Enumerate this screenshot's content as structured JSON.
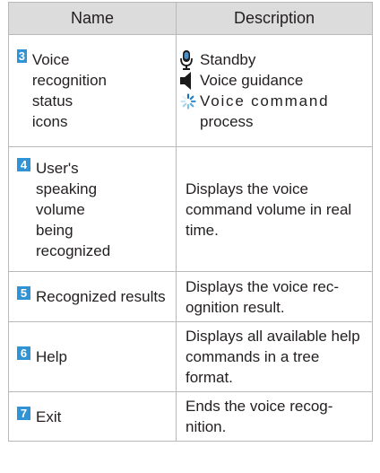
{
  "header": {
    "name": "Name",
    "description": "Description"
  },
  "rows": [
    {
      "num": "3",
      "name": "Voice recognition status icons",
      "status": [
        {
          "label": "Standby",
          "icon": "microphone-icon"
        },
        {
          "label": "Voice guidance",
          "icon": "speaker-icon"
        },
        {
          "label": "Voice command",
          "icon": "processing-spinner-icon"
        },
        {
          "label": "process"
        }
      ]
    },
    {
      "num": "4",
      "name": "User's speaking volume being recognized",
      "description": "Displays the voice command volume in real time."
    },
    {
      "num": "5",
      "name": "Recognized results",
      "description": "Displays the voice rec-ognition result."
    },
    {
      "num": "6",
      "name": "Help",
      "description": "Displays all available help commands in a tree format."
    },
    {
      "num": "7",
      "name": "Exit",
      "description": "Ends the voice recog-nition."
    }
  ],
  "colors": {
    "number_badge": "#2f93d6",
    "header_bg": "#dcdcdc",
    "border": "#b9b9b9"
  }
}
